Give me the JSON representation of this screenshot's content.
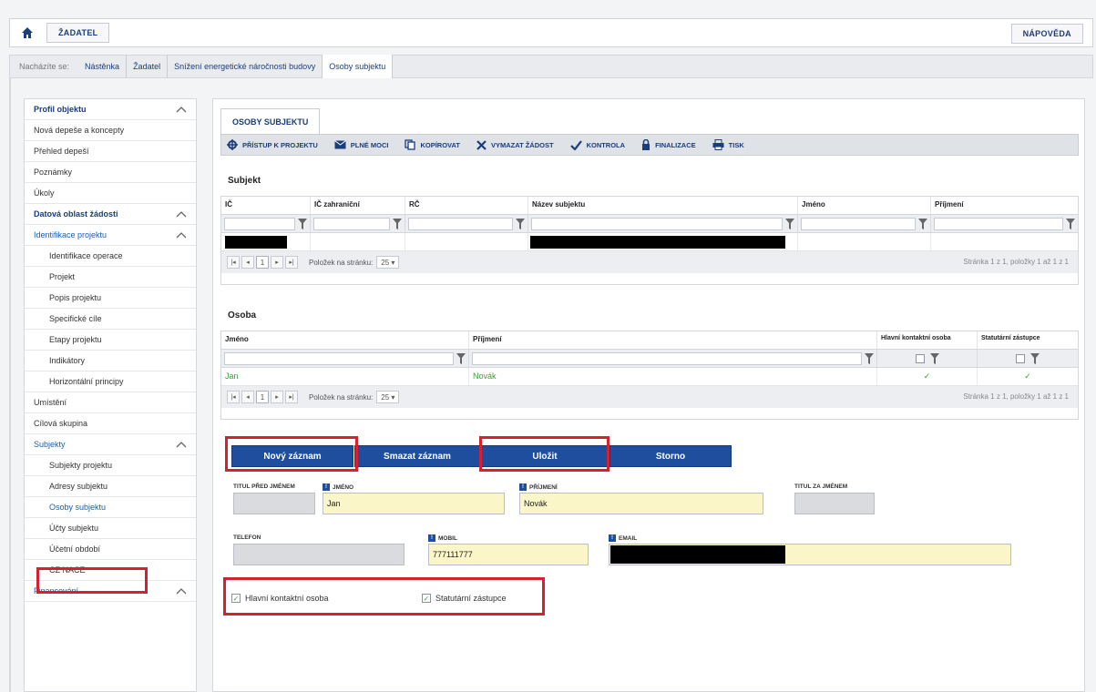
{
  "topbar": {
    "home_icon": "home-icon",
    "applicant_label": "ŽADATEL",
    "help_label": "NÁPOVĚDA"
  },
  "breadcrumb": {
    "prefix": "Nacházíte se:",
    "items": [
      "Nástěnka",
      "Žadatel",
      "Snížení energetické náročnosti budovy",
      "Osoby subjektu"
    ]
  },
  "sidebar": {
    "items": [
      {
        "label": "Profil objektu",
        "type": "head",
        "chevron": true
      },
      {
        "label": "Nová depeše a koncepty",
        "type": "item"
      },
      {
        "label": "Přehled depeší",
        "type": "item"
      },
      {
        "label": "Poznámky",
        "type": "item"
      },
      {
        "label": "Úkoly",
        "type": "item"
      },
      {
        "label": "Datová oblast žádosti",
        "type": "head",
        "chevron": true
      },
      {
        "label": "Identifikace projektu",
        "type": "group",
        "chevron": true
      },
      {
        "label": "Identifikace operace",
        "type": "sub"
      },
      {
        "label": "Projekt",
        "type": "sub"
      },
      {
        "label": "Popis projektu",
        "type": "sub"
      },
      {
        "label": "Specifické cíle",
        "type": "sub"
      },
      {
        "label": "Etapy projektu",
        "type": "sub"
      },
      {
        "label": "Indikátory",
        "type": "sub"
      },
      {
        "label": "Horizontální principy",
        "type": "sub"
      },
      {
        "label": "Umístění",
        "type": "item"
      },
      {
        "label": "Cílová skupina",
        "type": "item"
      },
      {
        "label": "Subjekty",
        "type": "group",
        "chevron": true
      },
      {
        "label": "Subjekty projektu",
        "type": "sub"
      },
      {
        "label": "Adresy subjektu",
        "type": "sub"
      },
      {
        "label": "Osoby subjektu",
        "type": "sub-selected"
      },
      {
        "label": "Účty subjektu",
        "type": "sub"
      },
      {
        "label": "Účetní období",
        "type": "sub"
      },
      {
        "label": "CZ NACE",
        "type": "sub"
      },
      {
        "label": "Financování",
        "type": "group",
        "chevron": true
      }
    ]
  },
  "main": {
    "tab_label": "OSOBY SUBJEKTU",
    "toolbar": [
      {
        "label": "PŘÍSTUP K PROJEKTU",
        "icon": "access-icon"
      },
      {
        "label": "PLNÉ MOCI",
        "icon": "mail-icon"
      },
      {
        "label": "KOPÍROVAT",
        "icon": "copy-icon"
      },
      {
        "label": "VYMAZAT ŽÁDOST",
        "icon": "delete-icon"
      },
      {
        "label": "KONTROLA",
        "icon": "check-icon"
      },
      {
        "label": "FINALIZACE",
        "icon": "lock-icon"
      },
      {
        "label": "TISK",
        "icon": "print-icon"
      }
    ],
    "subject_title": "Subjekt",
    "subject_columns": [
      "IČ",
      "IČ zahraniční",
      "RČ",
      "Název subjektu",
      "Jméno",
      "Příjmení"
    ],
    "pager": {
      "page": "1",
      "per_page_label": "Položek na stránku:",
      "per_page": "25",
      "info": "Stránka 1 z 1, položky 1 až 1 z 1"
    },
    "person_title": "Osoba",
    "person_columns": [
      "Jméno",
      "Příjmení",
      "Hlavní kontaktní osoba",
      "Statutární zástupce"
    ],
    "person_row": {
      "first_name": "Jan",
      "last_name": "Novák",
      "main_contact": "✓",
      "statutory": "✓"
    },
    "buttons": {
      "new": "Nový záznam",
      "delete": "Smazat záznam",
      "save": "Uložit",
      "cancel": "Storno"
    },
    "form": {
      "title_before_label": "TITUL PŘED JMÉNEM",
      "first_name_label": "JMÉNO",
      "first_name_value": "Jan",
      "last_name_label": "PŘÍJMENÍ",
      "last_name_value": "Novák",
      "title_after_label": "TITUL ZA JMÉNEM",
      "phone_label": "TELEFON",
      "mobile_label": "MOBIL",
      "mobile_value": "777111777",
      "email_label": "EMAIL",
      "main_contact_label": "Hlavní kontaktní osoba",
      "statutory_label": "Statutární zástupce",
      "required_mark": "!"
    }
  },
  "colors": {
    "accent": "#1f4e9e",
    "highlight": "#d7202f",
    "required_bg": "#fbf6c8"
  }
}
